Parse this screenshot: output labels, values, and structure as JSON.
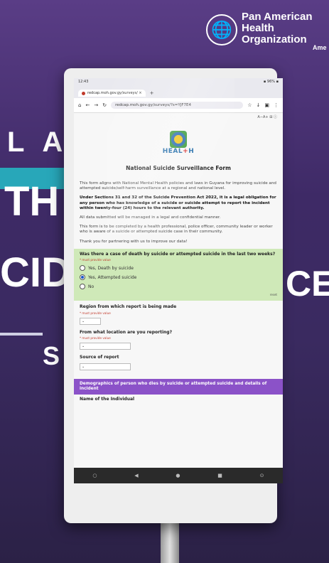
{
  "banner": {
    "org_name": "Pan American Health Organization",
    "org_line1": "Pan American",
    "org_line2": "Health",
    "org_line3": "Organization",
    "partial_right": "Ame",
    "backdrop_letters": [
      "L A",
      "TH",
      "CID",
      "CE",
      "S"
    ],
    "colors": {
      "purple": "#3e2a66",
      "teal": "#28a7b9"
    }
  },
  "device": {
    "status_time": "12:43",
    "status_right": "▪ 96% ▪",
    "tab_title": "redcap.moh.gov.gy/surveys/ ×",
    "new_tab": "+",
    "url": "redcap.moh.gov.gy/surveys/?s=YJF7E4",
    "aux_controls": "A−A+  ⊞  ⓘ",
    "nav_icons": [
      "○",
      "◀",
      "●",
      "■",
      "⊙"
    ]
  },
  "form": {
    "logo_word": "HEAL",
    "logo_cross": "+",
    "logo_word_end": "H",
    "title": "National Suicide Surveillance Form",
    "intro": "This form aligns with National Mental Health policies and laws in Guyana for improving suicide and attempted suicide/self-harm surveillance at a regional and national level.",
    "legal": "Under Sections 31 and 32 of the Suicide Prevention Act 2022, it is a legal obligation for any person who has knowledge of a suicide or suicide attempt to report the incident within twenty-four (24) hours to the relevant authority.",
    "confidential": "All data submitted will be managed in a legal and confidential manner.",
    "completed_by": "This form is to be completed by a health professional, police officer, community leader or worker who is aware of a suicide or attempted suicide case in their community.",
    "thanks": "Thank you for partnering with us to improve our data!",
    "q1": {
      "label": "Was there a case of death by suicide or attempted suicide in the last two weeks?",
      "required": "* must provide value",
      "options": [
        "Yes, Death by suicide",
        "Yes, Attempted suicide",
        "No"
      ],
      "selected_index": 1,
      "reset": "reset"
    },
    "q2": {
      "label": "Region from which report is being made",
      "required": "* must provide value",
      "value": "⌄"
    },
    "q3": {
      "label": "From what location are you reporting?",
      "required": "* must provide value",
      "value": "⌄"
    },
    "q4": {
      "label": "Source of report",
      "value": "⌄"
    },
    "section": "Demographics of person who dies by suicide or attempted suicide and details of incident",
    "name_label": "Name of the Individual"
  }
}
